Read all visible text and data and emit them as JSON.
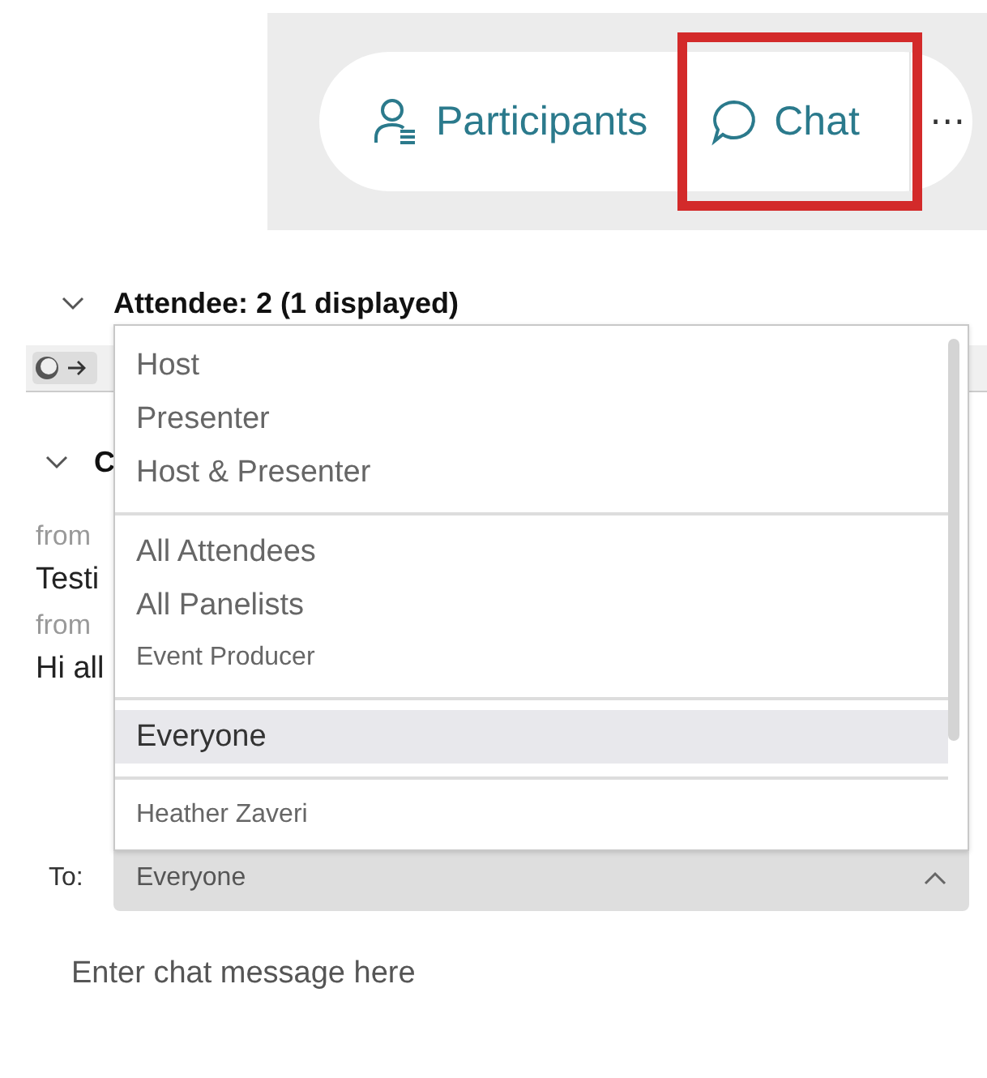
{
  "toolbar": {
    "tabs": [
      {
        "label": "Participants",
        "highlighted": false
      },
      {
        "label": "Chat",
        "highlighted": true
      }
    ],
    "more": "⋯"
  },
  "attendee_header": {
    "label": "Attendee: 2 (1 displayed)",
    "expanded": true
  },
  "chat_header": {
    "label": "C",
    "expanded": true
  },
  "messages": [
    {
      "from": "from",
      "text": "Testi"
    },
    {
      "from": "from",
      "text": "Hi all"
    }
  ],
  "recipient_menu": {
    "groups": [
      [
        {
          "label": "Host",
          "kind": "large",
          "selected": false
        },
        {
          "label": "Presenter",
          "kind": "large",
          "selected": false
        },
        {
          "label": "Host & Presenter",
          "kind": "large",
          "selected": false
        }
      ],
      [
        {
          "label": "All Attendees",
          "kind": "large",
          "selected": false
        },
        {
          "label": "All Panelists",
          "kind": "large",
          "selected": false
        },
        {
          "label": "Event Producer",
          "kind": "small",
          "selected": false
        }
      ],
      [
        {
          "label": "Everyone",
          "kind": "large",
          "selected": true
        }
      ],
      [
        {
          "label": "Heather Zaveri",
          "kind": "small",
          "selected": false
        }
      ]
    ]
  },
  "to_field": {
    "label": "To:",
    "value": "Everyone",
    "expanded": true
  },
  "message_field": {
    "placeholder": "Enter chat message here"
  }
}
